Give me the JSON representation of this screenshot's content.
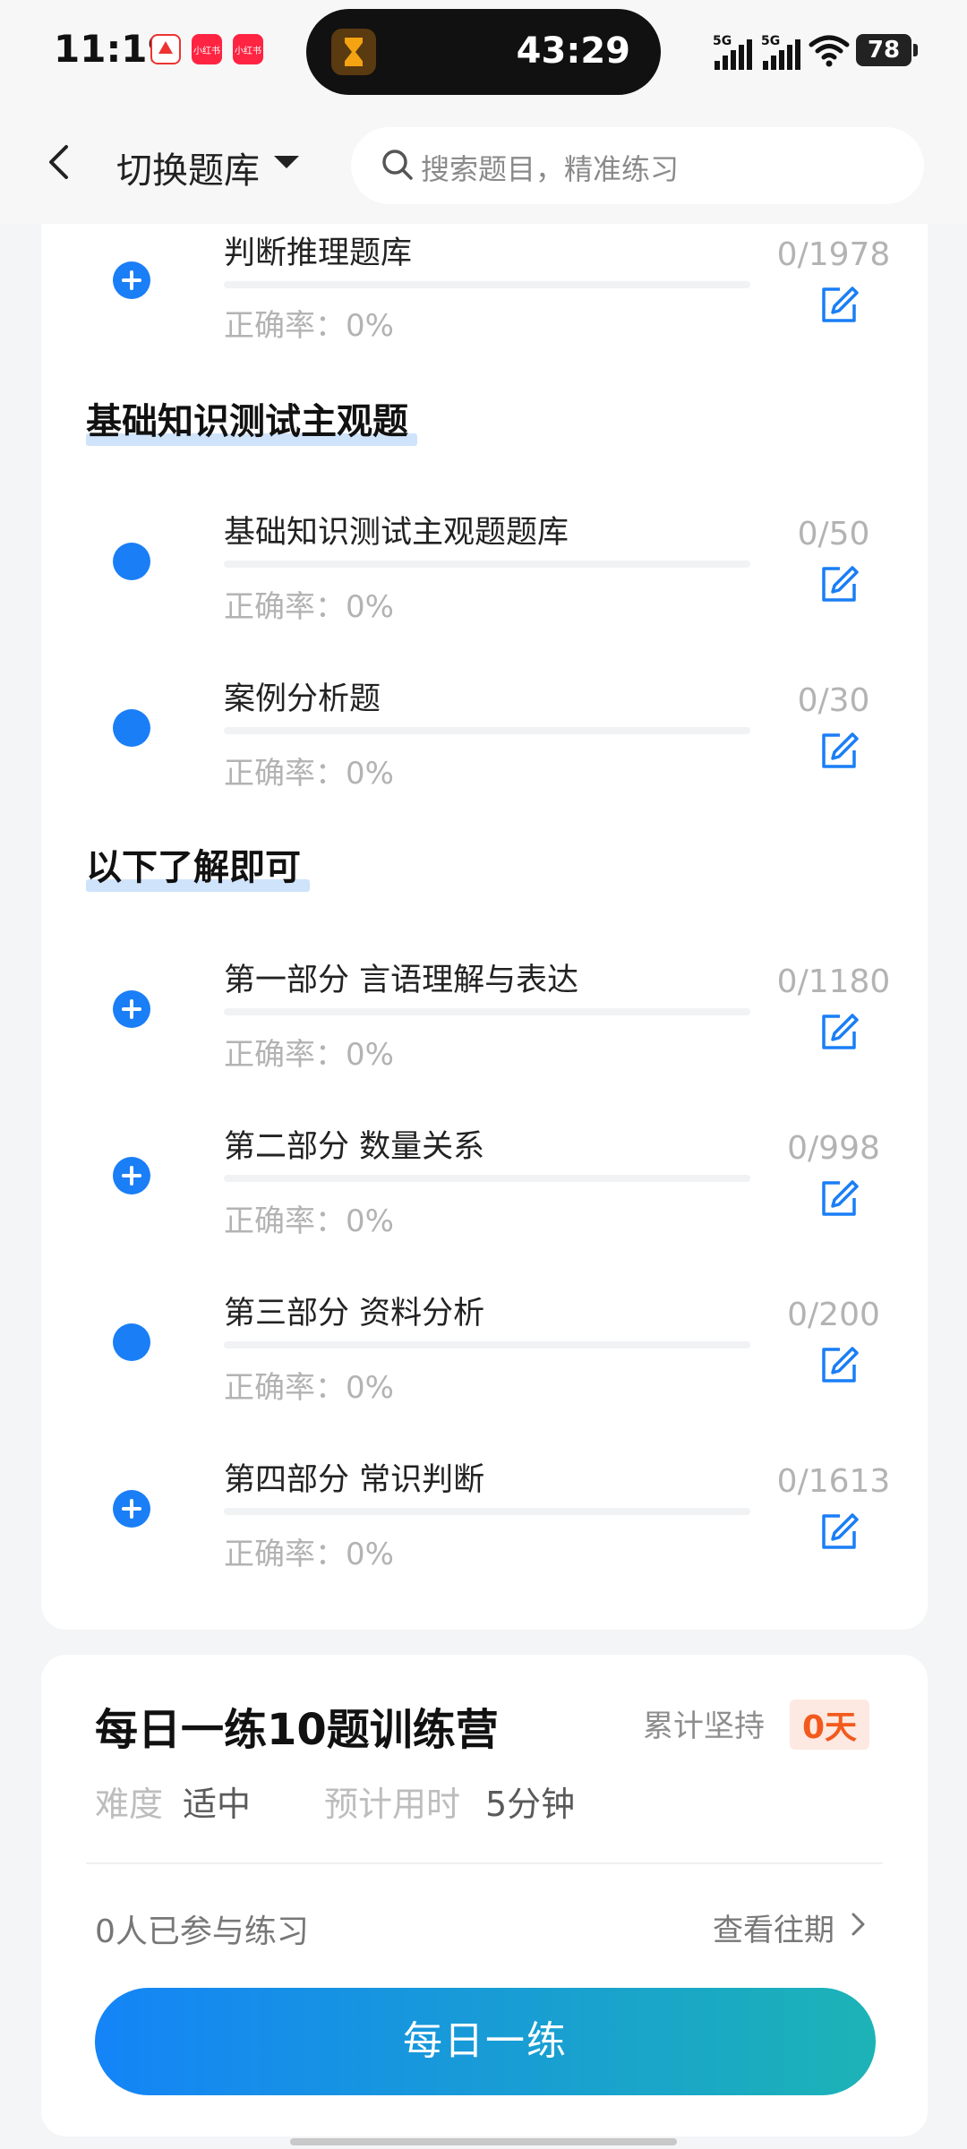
{
  "status": {
    "time": "11:19",
    "timer": "43:29",
    "battery": "78",
    "network": "5G",
    "notification_icons": [
      "app-icon",
      "xiaohongshu-icon",
      "xiaohongshu-icon"
    ],
    "notification_labels": [
      "小红书",
      "小红书"
    ]
  },
  "header": {
    "back_icon": "chevron-left-icon",
    "switch_label": "切换题库",
    "search_placeholder": "搜索题目，精准练习"
  },
  "list": {
    "items_top": [
      {
        "title": "判断推理题库",
        "accuracy": "正确率：0%",
        "count": "0/1978",
        "icon": "plus"
      }
    ],
    "section1": {
      "title": "基础知识测试主观题",
      "items": [
        {
          "title": "基础知识测试主观题题库",
          "accuracy": "正确率：0%",
          "count": "0/50",
          "icon": "dot"
        },
        {
          "title": "案例分析题",
          "accuracy": "正确率：0%",
          "count": "0/30",
          "icon": "dot"
        }
      ]
    },
    "section2": {
      "title": "以下了解即可",
      "items": [
        {
          "title": "第一部分 言语理解与表达",
          "accuracy": "正确率：0%",
          "count": "0/1180",
          "icon": "plus"
        },
        {
          "title": "第二部分 数量关系",
          "accuracy": "正确率：0%",
          "count": "0/998",
          "icon": "plus"
        },
        {
          "title": "第三部分 资料分析",
          "accuracy": "正确率：0%",
          "count": "0/200",
          "icon": "dot"
        },
        {
          "title": "第四部分 常识判断",
          "accuracy": "正确率：0%",
          "count": "0/1613",
          "icon": "plus"
        }
      ]
    }
  },
  "daily": {
    "title": "每日一练10题训练营",
    "persist_label": "累计坚持",
    "persist_days": "0天",
    "difficulty_label": "难度",
    "difficulty_value": "适中",
    "time_label": "预计用时",
    "time_value": "5分钟",
    "participants": "0人已参与练习",
    "history_link": "查看往期",
    "cta": "每日一练"
  },
  "colors": {
    "accent": "#1a7ef6",
    "badge_text": "#f25a1d",
    "badge_bg": "#fde9e1",
    "gradient_start": "#1484f7",
    "gradient_end": "#1cb3b6"
  }
}
